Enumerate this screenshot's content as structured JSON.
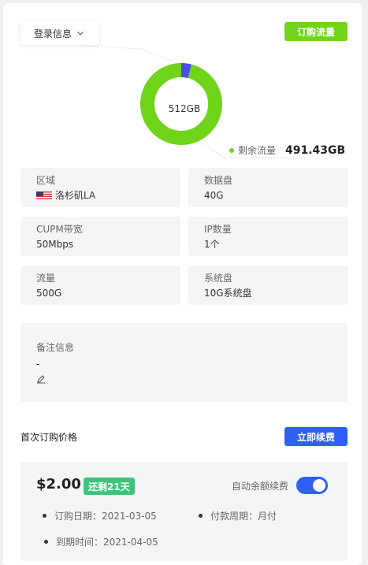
{
  "header": {
    "login_dropdown_label": "登录信息",
    "order_traffic_button": "订购流量"
  },
  "traffic": {
    "total": "512GB",
    "remaining_label": "剩余流量",
    "remaining_value": "491.43GB",
    "used_fraction": 0.0402,
    "colors": {
      "remaining": "#6fd41a",
      "used": "#4b4df0"
    }
  },
  "specs": [
    {
      "key": "区域",
      "value": "洛杉矶LA",
      "flag": "us-flag-icon"
    },
    {
      "key": "数据盘",
      "value": "40G"
    },
    {
      "key": "CUPM带宽",
      "value": "50Mbps"
    },
    {
      "key": "IP数量",
      "value": "1个"
    },
    {
      "key": "流量",
      "value": "500G"
    },
    {
      "key": "系统盘",
      "value": "10G系统盘"
    }
  ],
  "notes": {
    "label": "备注信息",
    "value": "-",
    "edit_icon": "pencil-icon"
  },
  "pricing": {
    "title": "首次订购价格",
    "renew_button": "立即续费",
    "price": "$2.00",
    "days_left_badge": "还剩21天",
    "auto_renew_label": "自动余额续费",
    "auto_renew_on": true,
    "order_date": "订购日期：2021-03-05",
    "payment_cycle": "付款周期：月付",
    "expire_date": "到期时间：2021-04-05"
  }
}
